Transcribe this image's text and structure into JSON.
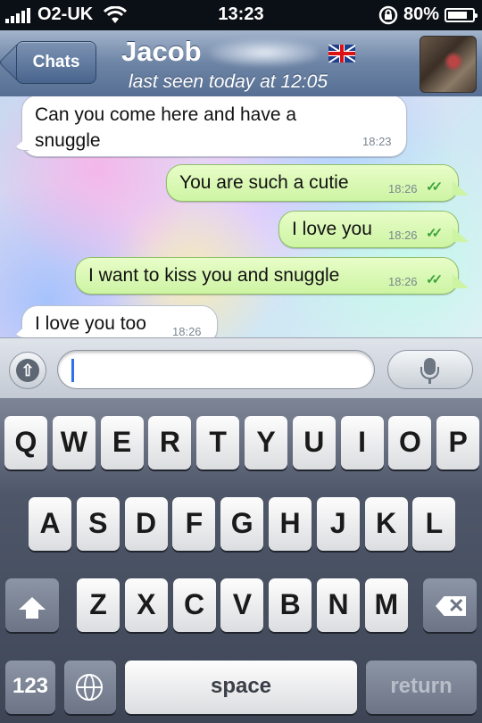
{
  "status_bar": {
    "carrier": "O2-UK",
    "time": "13:23",
    "battery": "80%",
    "battery_level": 0.8
  },
  "nav": {
    "back_label": "Chats",
    "contact_name": "Jacob",
    "last_seen": "last seen today at 12:05"
  },
  "messages": [
    {
      "direction": "in",
      "text_line1": "Can you come here and have a",
      "text_line2": "snuggle",
      "time": "18:23"
    },
    {
      "direction": "out",
      "text": "You are such a cutie",
      "time": "18:26",
      "ticks": "✓✓"
    },
    {
      "direction": "out",
      "text": "I love you",
      "time": "18:26",
      "ticks": "✓✓"
    },
    {
      "direction": "out",
      "text": "I want to kiss you and snuggle",
      "time": "18:26",
      "ticks": "✓✓"
    },
    {
      "direction": "in",
      "text": "I love you too",
      "time": "18:26"
    }
  ],
  "input": {
    "value": "",
    "placeholder": ""
  },
  "keyboard": {
    "row1": [
      "Q",
      "W",
      "E",
      "R",
      "T",
      "Y",
      "U",
      "I",
      "O",
      "P"
    ],
    "row2": [
      "A",
      "S",
      "D",
      "F",
      "G",
      "H",
      "J",
      "K",
      "L"
    ],
    "row3": [
      "Z",
      "X",
      "C",
      "V",
      "B",
      "N",
      "M"
    ],
    "numbers_label": "123",
    "space_label": "space",
    "return_label": "return"
  },
  "colors": {
    "nav_blue": "#6d84a5",
    "outgoing_bubble": "#cdf4a3",
    "read_ticks": "#3da53d",
    "cursor": "#2f6fe8"
  },
  "icons": [
    "signal-icon",
    "wifi-icon",
    "rotation-lock-icon",
    "battery-icon",
    "back-chevron-icon",
    "uk-flag-icon",
    "avatar",
    "attach-icon",
    "microphone-icon",
    "shift-icon",
    "backspace-icon",
    "globe-icon"
  ]
}
